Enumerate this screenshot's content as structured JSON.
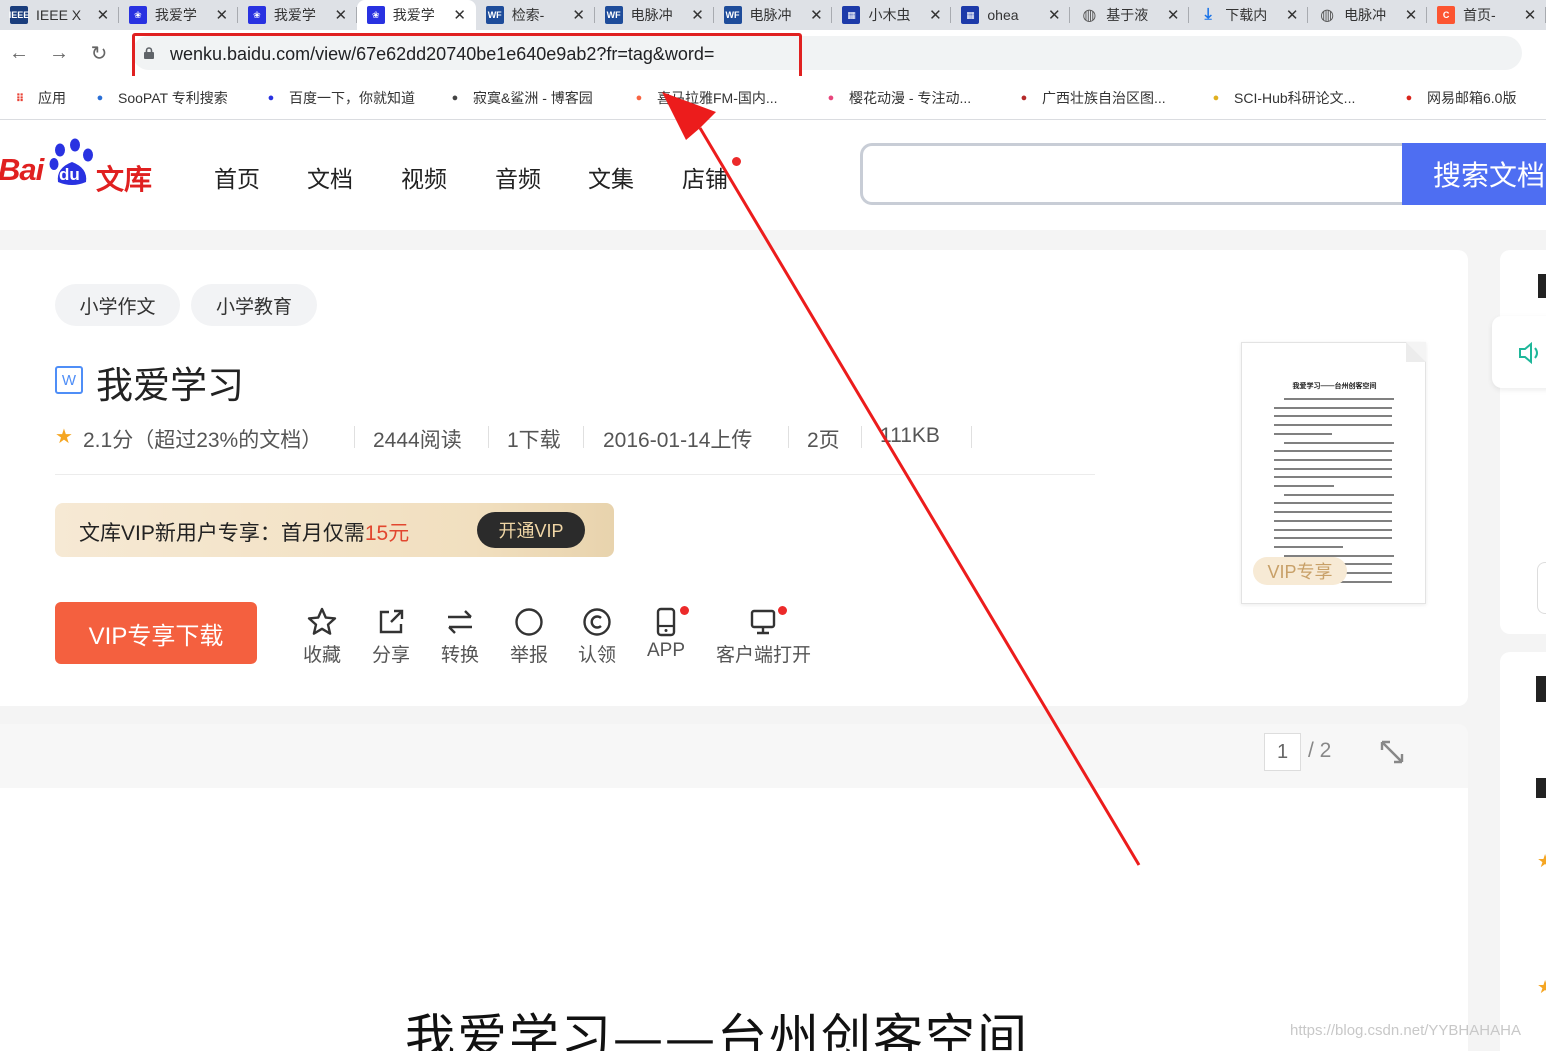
{
  "browser": {
    "tabs": [
      {
        "label": "IEEE X",
        "icon": "ieee-icon",
        "color": "#1a3d7c",
        "glyph": "IEEE"
      },
      {
        "label": "我爱学",
        "icon": "baidu-paw-icon",
        "color": "#2932e1",
        "glyph": "❀"
      },
      {
        "label": "我爱学",
        "icon": "baidu-paw-icon",
        "color": "#2932e1",
        "glyph": "❀"
      },
      {
        "label": "我爱学",
        "icon": "baidu-paw-icon",
        "color": "#2932e1",
        "glyph": "❀",
        "active": true
      },
      {
        "label": "检索-",
        "icon": "wanfang-icon",
        "color": "#1e4c9a",
        "glyph": "WF"
      },
      {
        "label": "电脉冲",
        "icon": "wanfang-icon",
        "color": "#1e4c9a",
        "glyph": "WF"
      },
      {
        "label": "电脉冲",
        "icon": "wanfang-icon",
        "color": "#1e4c9a",
        "glyph": "WF"
      },
      {
        "label": "小木虫",
        "icon": "xiaomuchong-icon",
        "color": "#1c3aa9",
        "glyph": "▦"
      },
      {
        "label": "ohea",
        "icon": "xiaomuchong-icon",
        "color": "#1c3aa9",
        "glyph": "▦"
      },
      {
        "label": "基于液",
        "icon": "globe-icon",
        "color": "#555555",
        "glyph": "◍"
      },
      {
        "label": "下载内",
        "icon": "download-icon",
        "color": "#1a73e8",
        "glyph": "⤓"
      },
      {
        "label": "电脉冲",
        "icon": "globe-icon",
        "color": "#555555",
        "glyph": "◍"
      },
      {
        "label": "首页-",
        "icon": "csdn-icon",
        "color": "#fc5531",
        "glyph": "C"
      }
    ],
    "tab_close": "✕",
    "url": "wenku.baidu.com/view/67e62dd20740be1e640e9ab2?fr=tag&word=",
    "bookmarks": [
      {
        "label": "应用",
        "icon": "apps-grid-icon",
        "color": "#e94235"
      },
      {
        "label": "SooPAT 专利搜索",
        "icon": "soopat-icon",
        "color": "#2a6fd6"
      },
      {
        "label": "百度一下，你就知道",
        "icon": "baidu-paw-icon",
        "color": "#2932e1"
      },
      {
        "label": "寂寞&鲨洲 - 博客园",
        "icon": "cnblogs-icon",
        "color": "#444444"
      },
      {
        "label": "喜马拉雅FM-国内...",
        "icon": "ximalaya-icon",
        "color": "#f86442"
      },
      {
        "label": "樱花动漫 - 专注动...",
        "icon": "sakura-icon",
        "color": "#e8467c"
      },
      {
        "label": "广西壮族自治区图...",
        "icon": "library-icon",
        "color": "#b52a2a"
      },
      {
        "label": "SCI-Hub科研论文...",
        "icon": "scihub-icon",
        "color": "#e0b020"
      },
      {
        "label": "网易邮箱6.0版",
        "icon": "netease-mail-icon",
        "color": "#d9251c"
      }
    ]
  },
  "site": {
    "logo_text": "Bai",
    "logo_du": "du",
    "logo_wenku": "文库",
    "nav": [
      "首页",
      "文档",
      "视频",
      "音频",
      "文集",
      "店铺"
    ],
    "search_button": "搜索文档",
    "search_placeholder": ""
  },
  "document": {
    "tags": [
      "小学作文",
      "小学教育"
    ],
    "type_icon": "W",
    "title": "我爱学习",
    "rating": "2.1分（超过23%的文档）",
    "reads": "2444阅读",
    "downloads": "1下载",
    "uploaded": "2016-01-14上传",
    "pages": "2页",
    "size": "111KB",
    "promo_text": "文库VIP新用户专享：首月仅需",
    "promo_price": "15元",
    "promo_button": "开通VIP",
    "download_button": "VIP专享下载",
    "actions": [
      {
        "label": "收藏",
        "icon": "star-outline-icon"
      },
      {
        "label": "分享",
        "icon": "share-icon"
      },
      {
        "label": "转换",
        "icon": "convert-arrows-icon"
      },
      {
        "label": "举报",
        "icon": "report-circle-icon"
      },
      {
        "label": "认领",
        "icon": "copyright-icon"
      },
      {
        "label": "APP",
        "icon": "phone-icon",
        "dot": true
      },
      {
        "label": "客户端打开",
        "icon": "monitor-icon",
        "dot": true
      }
    ],
    "preview_title": "我爱学习——台州创客空间",
    "vip_tag": "VIP专享"
  },
  "viewer": {
    "current_page": "1",
    "total_pages": "/ 2",
    "page_heading": "我爱学习——台州创客空间"
  },
  "watermark": "https://blog.csdn.net/YYBHAHAHA",
  "colors": {
    "accent": "#4e6ef2",
    "download": "#f4603f",
    "annotation_red": "#e02020",
    "promo_price": "#e2472f"
  }
}
